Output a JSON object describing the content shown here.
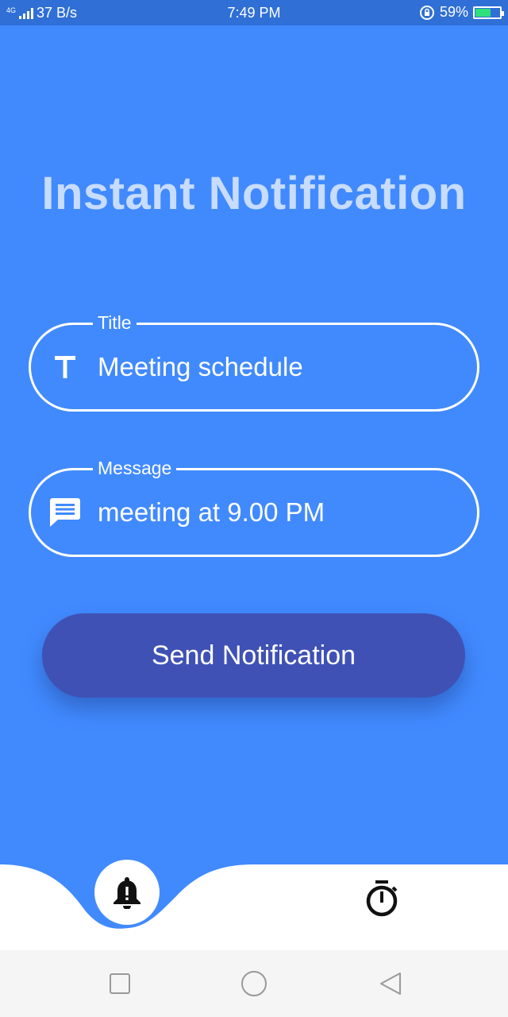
{
  "status_bar": {
    "network": "4G",
    "speed": "37 B/s",
    "time": "7:49 PM",
    "battery_percent": "59%",
    "battery_level": 0.59
  },
  "page": {
    "title": "Instant Notification"
  },
  "form": {
    "title_field": {
      "label": "Title",
      "value": "Meeting schedule",
      "icon": "text-format-icon"
    },
    "message_field": {
      "label": "Message",
      "value": "meeting at 9.00 PM",
      "icon": "message-icon"
    },
    "send_label": "Send Notification"
  },
  "bottom_nav": {
    "items": [
      {
        "icon": "bell-alert-icon",
        "active": true
      },
      {
        "icon": "stopwatch-icon",
        "active": false
      }
    ]
  },
  "system_nav": {
    "buttons": [
      "recents",
      "home",
      "back"
    ]
  },
  "colors": {
    "background": "#418AFE",
    "status_bar": "#2F6FD6",
    "button": "#3F51B5",
    "title_text": "#C7DCFF"
  }
}
